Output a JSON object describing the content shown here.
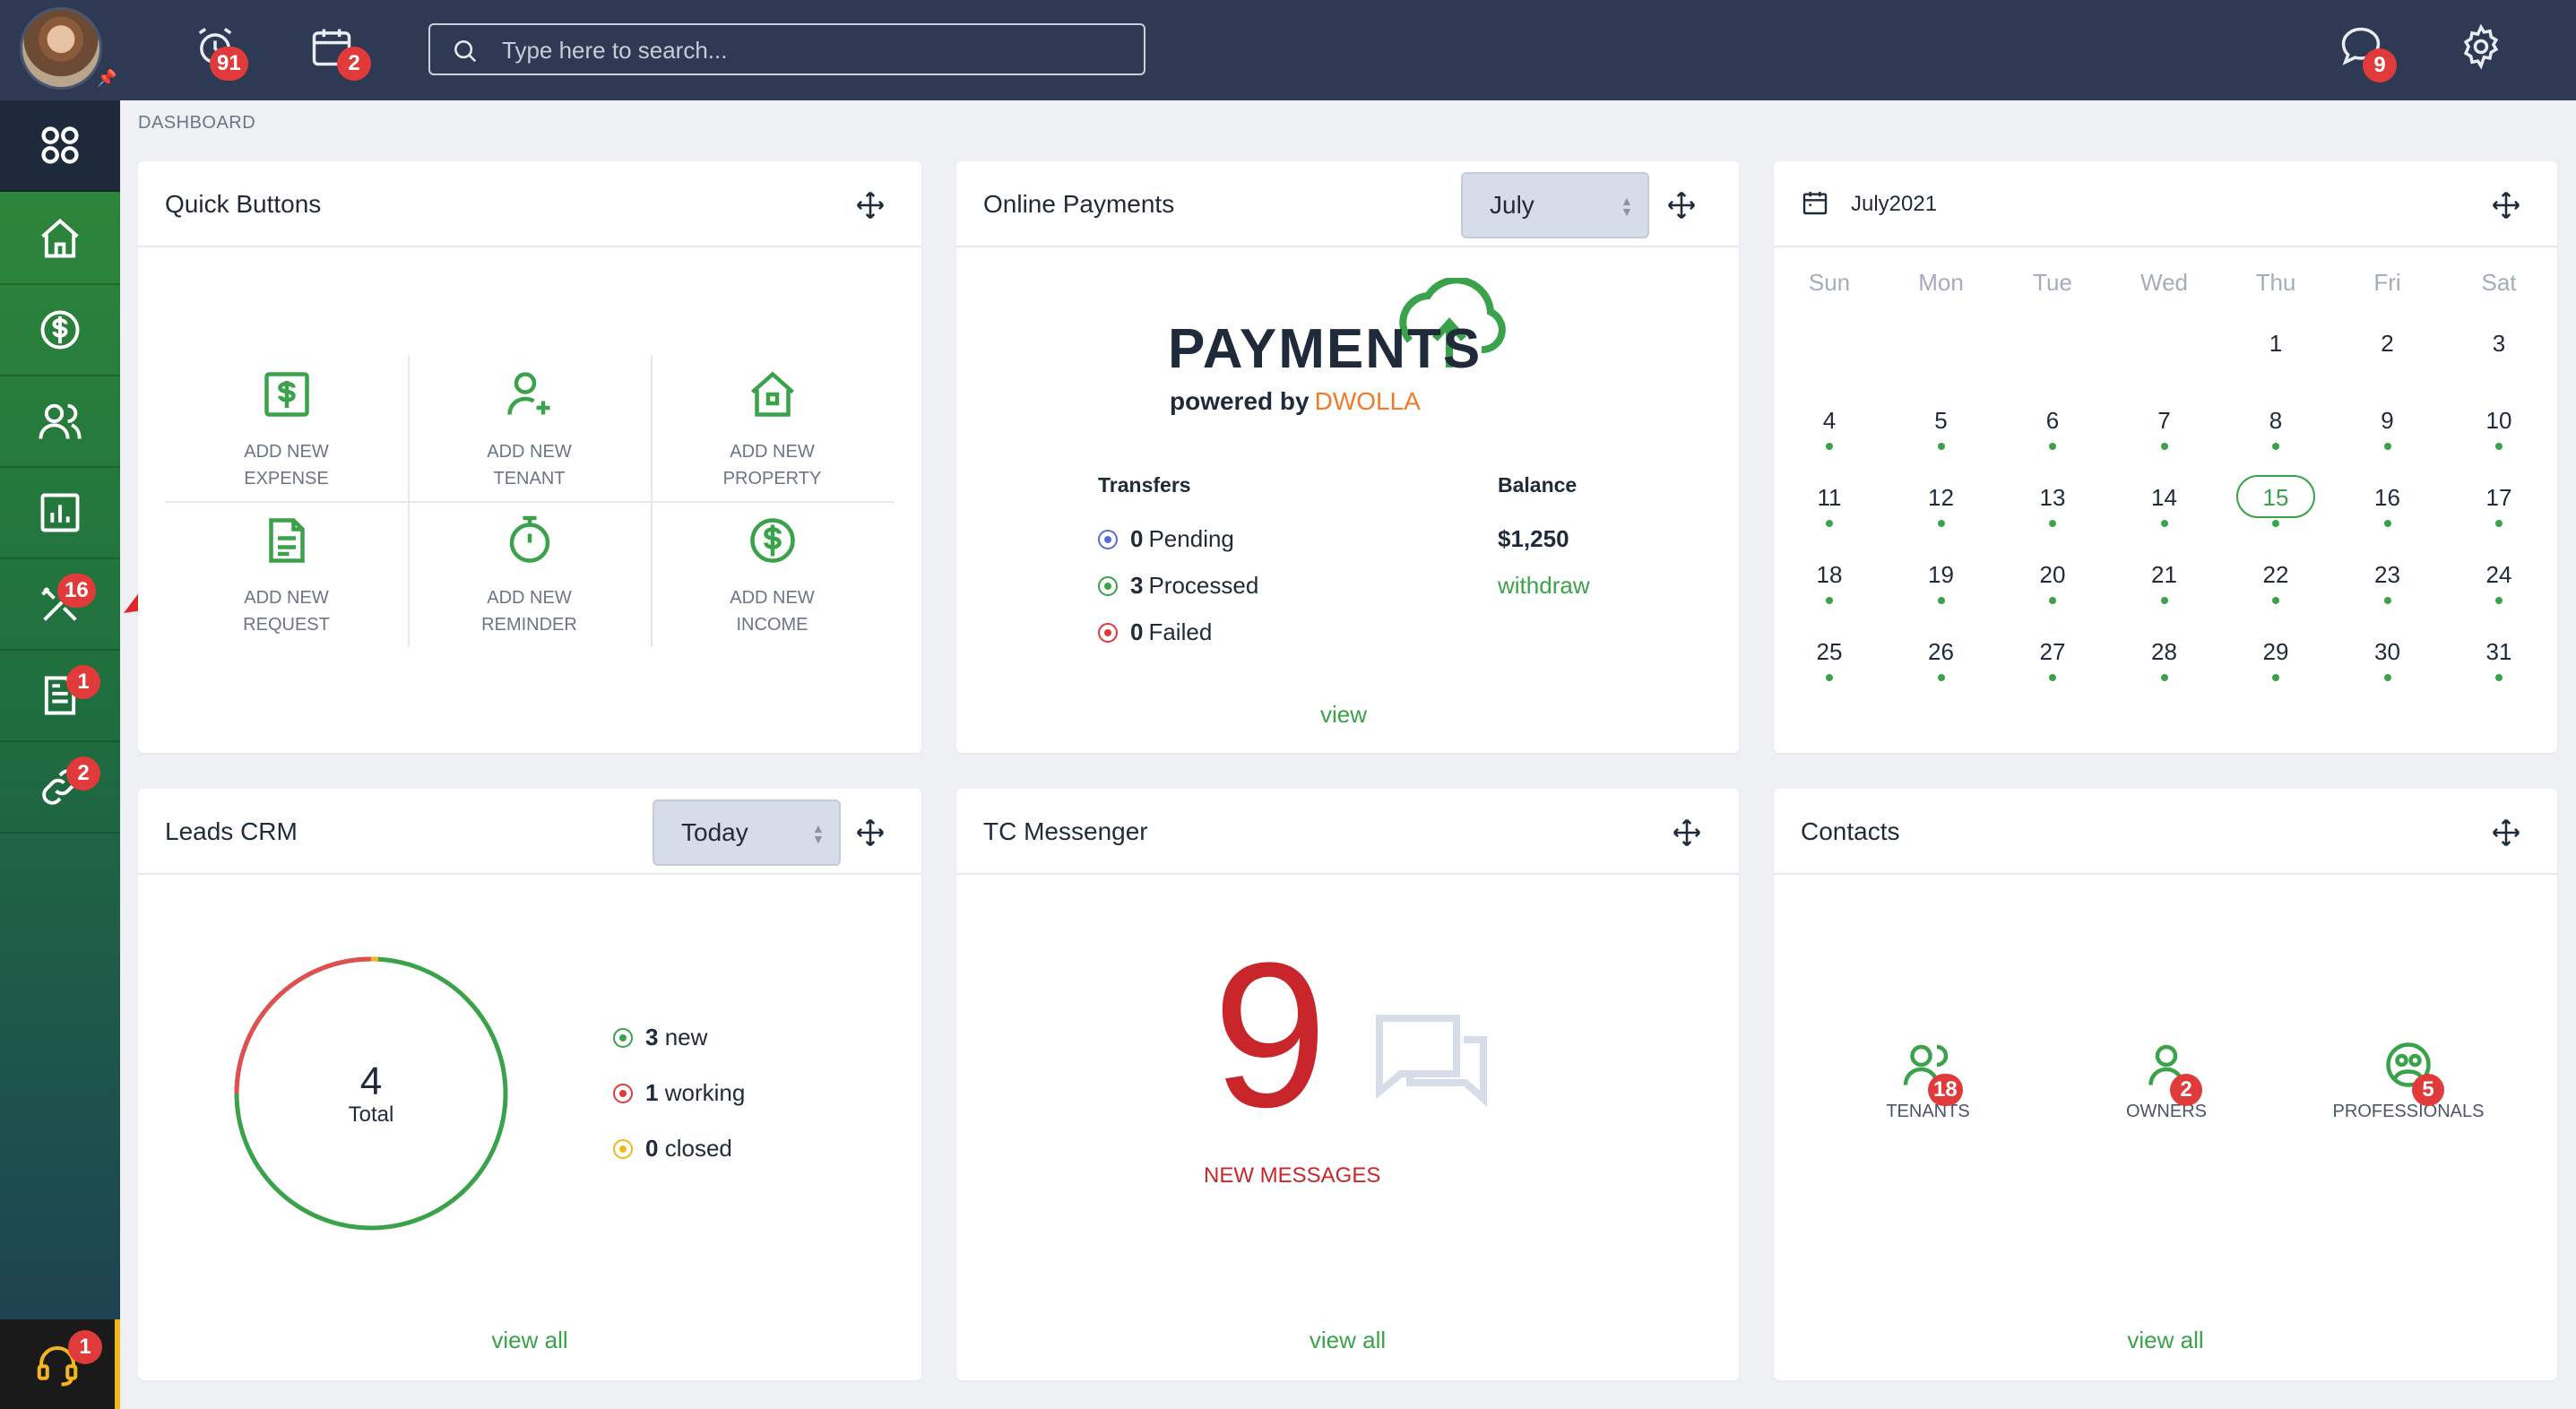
{
  "header": {
    "search_placeholder": "Type here to search...",
    "alarm_badge": "91",
    "calendar_badge": "2",
    "chat_badge": "9"
  },
  "sidebar": {
    "tools_badge": "16",
    "documents_badge": "1",
    "links_badge": "2",
    "support_badge": "1"
  },
  "breadcrumb": "DASHBOARD",
  "quick_buttons": {
    "title": "Quick Buttons",
    "items": [
      {
        "label": "ADD NEW\nEXPENSE",
        "icon": "dollar-doc-icon"
      },
      {
        "label": "ADD NEW\nTENANT",
        "icon": "add-user-icon"
      },
      {
        "label": "ADD NEW\nPROPERTY",
        "icon": "house-icon"
      },
      {
        "label": "ADD NEW\nREQUEST",
        "icon": "document-icon"
      },
      {
        "label": "ADD NEW\nREMINDER",
        "icon": "stopwatch-icon"
      },
      {
        "label": "ADD NEW\nINCOME",
        "icon": "dollar-circle-icon"
      }
    ]
  },
  "online_payments": {
    "title": "Online Payments",
    "month": "July",
    "logo_word": "PAYMENTS",
    "powered_by": "powered by",
    "powered_brand": "DWOLLA",
    "transfers_header": "Transfers",
    "balance_header": "Balance",
    "pending_count": "0",
    "pending_label": "Pending",
    "processed_count": "3",
    "processed_label": "Processed",
    "failed_count": "0",
    "failed_label": "Failed",
    "balance": "$1,250",
    "withdraw": "withdraw",
    "view": "view"
  },
  "calendar": {
    "title": "July2021",
    "days_of_week": [
      "Sun",
      "Mon",
      "Tue",
      "Wed",
      "Thu",
      "Fri",
      "Sat"
    ],
    "today": "15"
  },
  "leads": {
    "title": "Leads CRM",
    "period": "Today",
    "total": "4",
    "total_label": "Total",
    "new_count": "3",
    "new_label": "new",
    "working_count": "1",
    "working_label": "working",
    "closed_count": "0",
    "closed_label": "closed",
    "view_all": "view all"
  },
  "messenger": {
    "title": "TC Messenger",
    "count": "9",
    "label": "NEW MESSAGES",
    "view_all": "view all"
  },
  "contacts": {
    "title": "Contacts",
    "tenants_count": "18",
    "tenants_label": "TENANTS",
    "owners_count": "2",
    "owners_label": "OWNERS",
    "professionals_count": "5",
    "professionals_label": "PROFESSIONALS",
    "view_all": "view all"
  },
  "colors": {
    "accent_green": "#3aa24a",
    "badge_red": "#e03a3a",
    "topbar": "#2e3a54",
    "messages_red": "#c8262b"
  }
}
